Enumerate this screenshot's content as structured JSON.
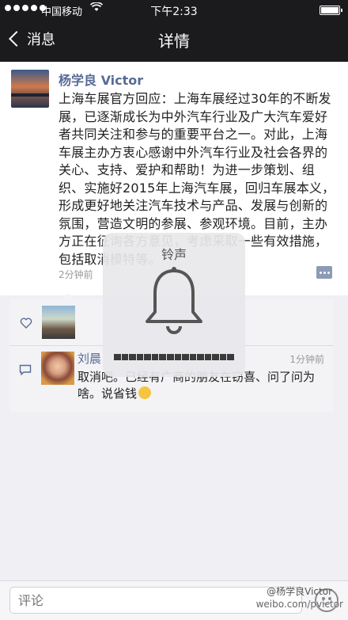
{
  "status": {
    "carrier": "中国移动",
    "wifi_icon": "wifi-icon",
    "time": "下午2:33"
  },
  "nav": {
    "back_label": "消息",
    "title": "详情"
  },
  "post": {
    "author": "杨学良 Victor",
    "content": "上海车展官方回应：上海车展经过30年的不断发展，已逐渐成长为中外汽车行业及广大汽车爱好者共同关注和参与的重要平台之一。对此，上海车展主办方衷心感谢中外汽车行业及社会各界的关心、支持、爱护和帮助！为进一步策划、组织、实施好2015年上海汽车展，回归车展本义，形成更好地关注汽车技术与产品、发展与创新的氛围，营造文明的参展、参观环境。目前，主办方正在征询各方意见，考虑采取一些有效措施，包括取消模特等。",
    "time": "2分钟前"
  },
  "comment": {
    "author": "刘晨",
    "time": "1分钟前",
    "text": "取消吧。已经有广商的朋友在窃喜、问了问为啥。说省钱"
  },
  "hud": {
    "title": "铃声",
    "icon": "bell-icon",
    "volume_level": 1.0
  },
  "input": {
    "placeholder": "评论"
  },
  "watermark": {
    "line1": "@杨学良Victor",
    "line2": "weibo.com/pvictor"
  }
}
